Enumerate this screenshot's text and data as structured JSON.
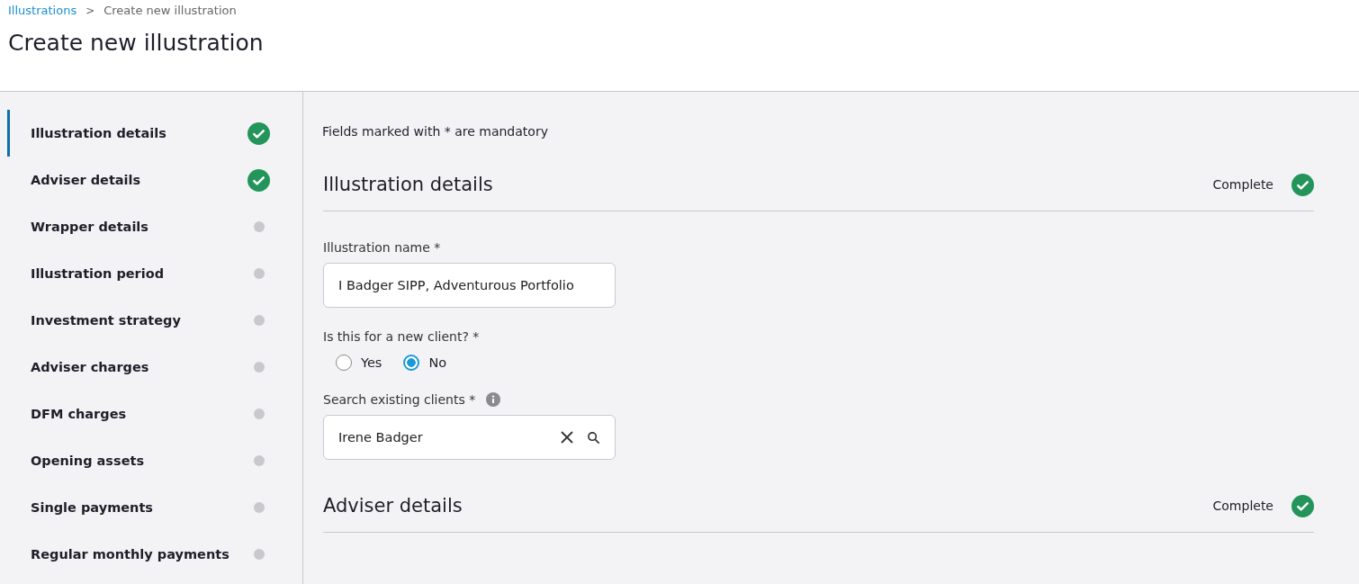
{
  "breadcrumb": [
    {
      "label": "Illustrations",
      "link": true
    },
    {
      "label": "Create new illustration",
      "link": false
    }
  ],
  "breadcrumb_separator": ">",
  "title": "Create new illustration",
  "sidebar": {
    "items": [
      {
        "label": "Illustration details",
        "complete": true,
        "selected": true
      },
      {
        "label": "Adviser details",
        "complete": true,
        "selected": false
      },
      {
        "label": "Wrapper details",
        "complete": false,
        "selected": false
      },
      {
        "label": "Illustration period",
        "complete": false,
        "selected": false
      },
      {
        "label": "Investment strategy",
        "complete": false,
        "selected": false
      },
      {
        "label": "Adviser charges",
        "complete": false,
        "selected": false
      },
      {
        "label": "DFM charges",
        "complete": false,
        "selected": false
      },
      {
        "label": "Opening assets",
        "complete": false,
        "selected": false
      },
      {
        "label": "Single payments",
        "complete": false,
        "selected": false
      },
      {
        "label": "Regular monthly payments",
        "complete": false,
        "selected": false
      }
    ]
  },
  "mandatory_note": "Fields marked with * are mandatory",
  "sections": [
    {
      "title": "Illustration details",
      "status": "Complete",
      "complete": true,
      "fields": [
        {
          "kind": "text",
          "label": "Illustration name *",
          "value": "I Badger SIPP, Adventurous Portfolio"
        },
        {
          "kind": "radio",
          "label": "Is this for a new client? *",
          "options": [
            {
              "label": "Yes",
              "selected": false
            },
            {
              "label": "No",
              "selected": true
            }
          ]
        },
        {
          "kind": "search",
          "label": "Search existing clients *",
          "info": true,
          "value": "Irene Badger"
        }
      ]
    },
    {
      "title": "Adviser details",
      "status": "Complete",
      "complete": true
    }
  ]
}
